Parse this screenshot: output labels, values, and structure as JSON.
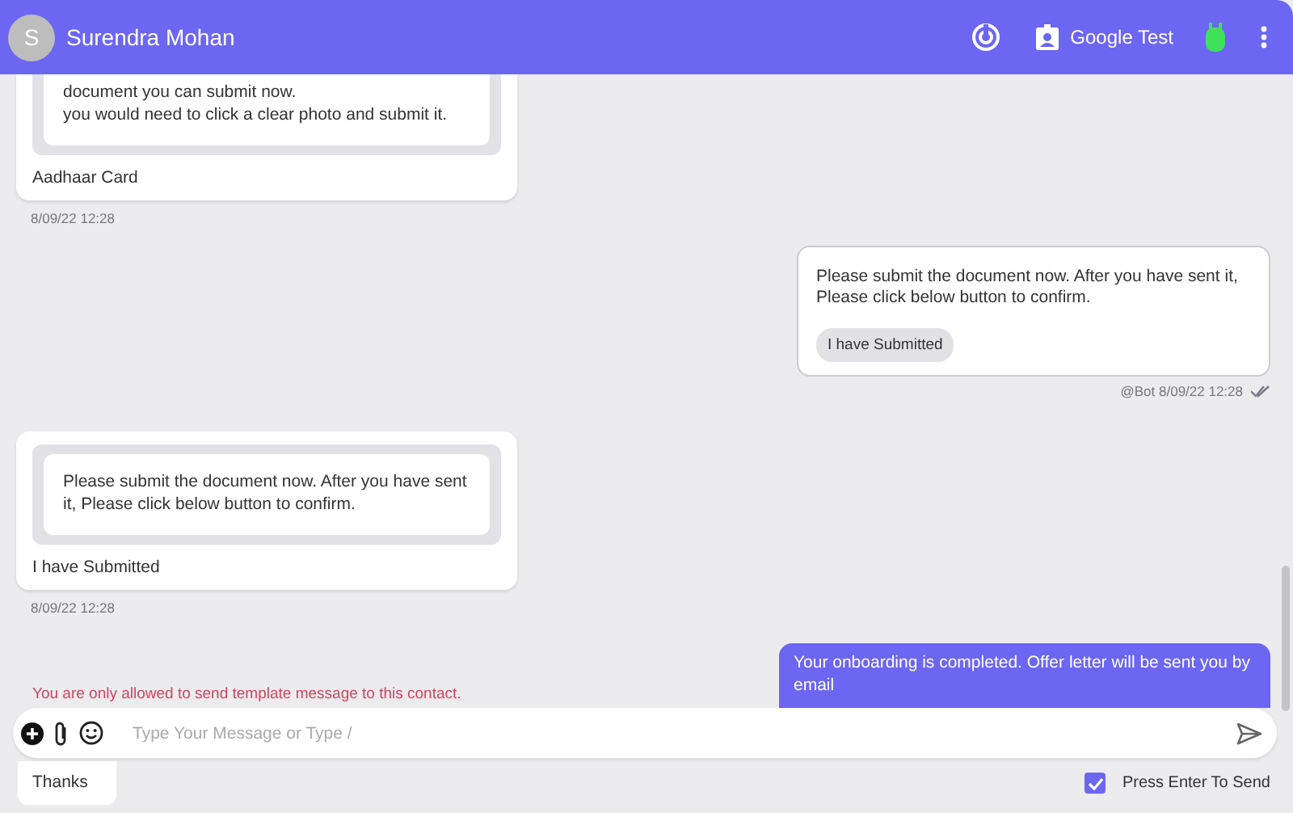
{
  "header": {
    "avatar_letter": "S",
    "name": "Surendra Mohan",
    "account": "Google Test"
  },
  "messages": [
    {
      "kind": "incoming",
      "quote_lines": [
        "document you can submit now.",
        " you would need to click a clear photo and submit it."
      ],
      "text": "Aadhaar Card",
      "time": "8/09/22 12:28"
    },
    {
      "kind": "template",
      "text": "Please submit the document now. After you have sent it, Please click below button to confirm.",
      "button_label": "I have Submitted",
      "meta": "@Bot 8/09/22 12:28",
      "read": true
    },
    {
      "kind": "incoming",
      "quote_lines": [
        "Please submit the document now. After you have sent it, Please click below button to confirm."
      ],
      "text": "I have Submitted",
      "time": "8/09/22 12:28"
    }
  ],
  "notice": "You are only allowed to send template message to this contact.",
  "last_message": "Your onboarding is completed. Offer letter will be sent you by email",
  "composer": {
    "placeholder": "Type Your Message or Type /"
  },
  "quick_replies": [
    "Thanks"
  ],
  "press_enter": {
    "label": "Press Enter To Send",
    "checked": true
  }
}
